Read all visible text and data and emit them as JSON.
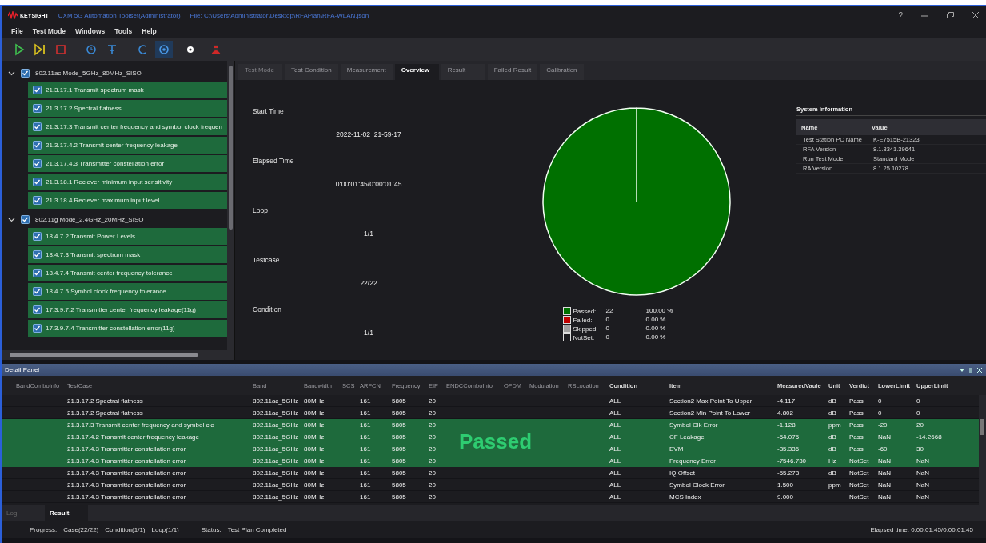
{
  "window": {
    "brand": "KEYSIGHT",
    "title": "UXM 5G Automation Toolset(Administrator)",
    "file": "File: C:\\Users\\Administrator\\Desktop\\RFAPlan\\RFA-WLAN.json",
    "help": "?"
  },
  "menu": [
    "File",
    "Test Mode",
    "Windows",
    "Tools",
    "Help"
  ],
  "tree": [
    {
      "label": "802.11ac Mode_5GHz_80MHz_SISO",
      "expanded": true,
      "checked": true,
      "children": [
        {
          "label": "21.3.17.1 Transmit spectrum mask",
          "checked": true
        },
        {
          "label": "21.3.17.2 Spectral flatness",
          "checked": true
        },
        {
          "label": "21.3.17.3 Transmit center frequency and symbol clock frequen",
          "checked": true
        },
        {
          "label": "21.3.17.4.2 Transmit center frequency leakage",
          "checked": true
        },
        {
          "label": "21.3.17.4.3 Transmitter constellation error",
          "checked": true
        },
        {
          "label": "21.3.18.1 Reciever minimum input sensitivity",
          "checked": true
        },
        {
          "label": "21.3.18.4 Reciever maximum input level",
          "checked": true
        }
      ]
    },
    {
      "label": "802.11g Mode_2.4GHz_20MHz_SISO",
      "expanded": true,
      "checked": true,
      "children": [
        {
          "label": "18.4.7.2 Transmit Power Levels",
          "checked": true
        },
        {
          "label": "18.4.7.3 Transmit spectrum mask",
          "checked": true
        },
        {
          "label": "18.4.7.4 Transmit center frequency tolerance",
          "checked": true
        },
        {
          "label": "18.4.7.5 Symbol clock frequency tolerance",
          "checked": true
        },
        {
          "label": "17.3.9.7.2 Transmitter center frequency leakage(11g)",
          "checked": true
        },
        {
          "label": "17.3.9.7.4 Transmitter constellation error(11g)",
          "checked": true
        }
      ]
    }
  ],
  "tabs": [
    {
      "label": "Test Mode",
      "selected": false,
      "disabled": true
    },
    {
      "label": "Test Condition",
      "selected": false,
      "disabled": false
    },
    {
      "label": "Measurement",
      "selected": false,
      "disabled": false
    },
    {
      "label": "Overview",
      "selected": true,
      "disabled": false
    },
    {
      "label": "Result",
      "selected": false,
      "disabled": false
    },
    {
      "label": "Failed Result",
      "selected": false,
      "disabled": false
    },
    {
      "label": "Calibration",
      "selected": false,
      "disabled": false
    }
  ],
  "overview": {
    "fields": [
      {
        "label": "Start Time",
        "value": "2022-11-02_21-59-17"
      },
      {
        "label": "Elapsed Time",
        "value": "0:00:01:45/0:00:01:45"
      },
      {
        "label": "Loop",
        "value": "1/1"
      },
      {
        "label": "Testcase",
        "value": "22/22"
      },
      {
        "label": "Condition",
        "value": "1/1"
      }
    ],
    "chart_data": {
      "type": "pie",
      "values": [
        100,
        0,
        0,
        0
      ]
    },
    "legend": [
      {
        "label": "Passed:",
        "count": "22",
        "percent": "100.00 %",
        "color": "#007000"
      },
      {
        "label": "Failed:",
        "count": "0",
        "percent": "0.00 %",
        "color": "#c00000"
      },
      {
        "label": "Skipped:",
        "count": "0",
        "percent": "0.00 %",
        "color": "#a0a0a0"
      },
      {
        "label": "NotSet:",
        "count": "0",
        "percent": "0.00 %",
        "color": "#1b1b1f"
      }
    ],
    "system_info": {
      "title": "System Information",
      "columns": [
        "Name",
        "Value"
      ],
      "rows": [
        [
          "Test Station PC Name",
          "K-E7515B-21323"
        ],
        [
          "RFA Version",
          "8.1.8341.39641"
        ],
        [
          "Run Test Mode",
          "Standard Mode"
        ],
        [
          "RA Version",
          "8.1.25.10278"
        ]
      ]
    }
  },
  "detail_panel": {
    "title": "Detail Panel",
    "overlay": "Passed",
    "columns": [
      "BandComboInfo",
      "TestCase",
      "Band",
      "Bandwidth",
      "SCS",
      "ARFCN",
      "Frequency",
      "EIP",
      "ENDCComboInfo",
      "OFDM",
      "Modulation",
      "RSLocation",
      "Condition",
      "Item",
      "MeasuredVaule",
      "Unit",
      "Verdict",
      "LowerLimit",
      "UpperLimit"
    ],
    "rows": [
      {
        "selected": false,
        "test_case": "21.3.17.2 Spectral flatness",
        "band": "802.11ac_5GHz",
        "bandwidth": "80MHz",
        "arfcn": "161",
        "frequency": "5805",
        "eip": "20",
        "condition": "ALL",
        "item": "Section2 Max Point To Upper",
        "measured": "-4.117",
        "unit": "dB",
        "verdict": "Pass",
        "lower": "0",
        "upper": "0"
      },
      {
        "selected": false,
        "test_case": "21.3.17.2 Spectral flatness",
        "band": "802.11ac_5GHz",
        "bandwidth": "80MHz",
        "arfcn": "161",
        "frequency": "5805",
        "eip": "20",
        "condition": "ALL",
        "item": "Section2 Min Point To Lower",
        "measured": "4.802",
        "unit": "dB",
        "verdict": "Pass",
        "lower": "0",
        "upper": "0"
      },
      {
        "selected": true,
        "test_case": "21.3.17.3 Transmit center frequency and symbol clc",
        "band": "802.11ac_5GHz",
        "bandwidth": "80MHz",
        "arfcn": "161",
        "frequency": "5805",
        "eip": "20",
        "condition": "ALL",
        "item": "Symbol Clk Error",
        "measured": "-1.128",
        "unit": "ppm",
        "verdict": "Pass",
        "lower": "-20",
        "upper": "20"
      },
      {
        "selected": true,
        "test_case": "21.3.17.4.2 Transmit center frequency leakage",
        "band": "802.11ac_5GHz",
        "bandwidth": "80MHz",
        "arfcn": "161",
        "frequency": "5805",
        "eip": "20",
        "condition": "ALL",
        "item": "CF Leakage",
        "measured": "-54.075",
        "unit": "dB",
        "verdict": "Pass",
        "lower": "NaN",
        "upper": "-14.2668"
      },
      {
        "selected": true,
        "test_case": "21.3.17.4.3 Transmitter constellation error",
        "band": "802.11ac_5GHz",
        "bandwidth": "80MHz",
        "arfcn": "161",
        "frequency": "5805",
        "eip": "20",
        "condition": "ALL",
        "item": "EVM",
        "measured": "-35.336",
        "unit": "dB",
        "verdict": "Pass",
        "lower": "-60",
        "upper": "30"
      },
      {
        "selected": true,
        "test_case": "21.3.17.4.3 Transmitter constellation error",
        "band": "802.11ac_5GHz",
        "bandwidth": "80MHz",
        "arfcn": "161",
        "frequency": "5805",
        "eip": "20",
        "condition": "ALL",
        "item": "Frequency Error",
        "measured": "-7546.730",
        "unit": "Hz",
        "verdict": "NotSet",
        "lower": "NaN",
        "upper": "NaN"
      },
      {
        "selected": false,
        "test_case": "21.3.17.4.3 Transmitter constellation error",
        "band": "802.11ac_5GHz",
        "bandwidth": "80MHz",
        "arfcn": "161",
        "frequency": "5805",
        "eip": "20",
        "condition": "ALL",
        "item": "IQ Offset",
        "measured": "-55.278",
        "unit": "dB",
        "verdict": "NotSet",
        "lower": "NaN",
        "upper": "NaN"
      },
      {
        "selected": false,
        "test_case": "21.3.17.4.3 Transmitter constellation error",
        "band": "802.11ac_5GHz",
        "bandwidth": "80MHz",
        "arfcn": "161",
        "frequency": "5805",
        "eip": "20",
        "condition": "ALL",
        "item": "Symbol Clock Error",
        "measured": "1.500",
        "unit": "ppm",
        "verdict": "NotSet",
        "lower": "NaN",
        "upper": "NaN"
      },
      {
        "selected": false,
        "test_case": "21.3.17.4.3 Transmitter constellation error",
        "band": "802.11ac_5GHz",
        "bandwidth": "80MHz",
        "arfcn": "161",
        "frequency": "5805",
        "eip": "20",
        "condition": "ALL",
        "item": "MCS Index",
        "measured": "9.000",
        "verdict": "NotSet",
        "lower": "NaN",
        "upper": "NaN"
      }
    ]
  },
  "bottom_tabs": [
    {
      "label": "Log",
      "selected": false
    },
    {
      "label": "Result",
      "selected": true
    }
  ],
  "status_bar": {
    "progress_label": "Progress:",
    "case": "Case(22/22)",
    "condition": "Condition(1/1)",
    "loop": "Loop(1/1)",
    "status_label": "Status:",
    "status": "Test Plan Completed",
    "elapsed": "Elapsed time: 0:00:01:45/0:00:01:45"
  }
}
